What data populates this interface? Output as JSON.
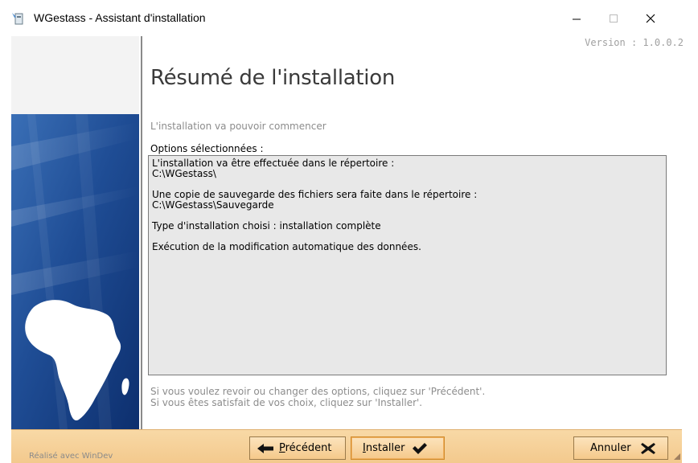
{
  "window": {
    "title": "WGestass - Assistant d'installation",
    "icon": "installer-icon"
  },
  "version": "Version : 1.0.0.2",
  "page": {
    "title": "Résumé de l'installation",
    "intro": "L'installation va pouvoir commencer",
    "options_label": "Options sélectionnées :",
    "summary": "L'installation va être effectuée dans le répertoire :\nC:\\WGestass\\\n\nUne copie de sauvegarde des fichiers sera faite dans le répertoire :\nC:\\WGestass\\Sauvegarde\n\nType d'installation choisi : installation complète\n\nExécution de la modification automatique des données.",
    "footer_line1": "Si vous voulez revoir ou changer des options, cliquez sur 'Précédent'.",
    "footer_line2": "Si vous êtes satisfait de vos choix, cliquez sur 'Installer'."
  },
  "footer": {
    "made_with": "Réalisé avec WinDev"
  },
  "buttons": {
    "prev_first": "P",
    "prev_rest": "récédent",
    "install_first": "I",
    "install_rest": "nstaller",
    "cancel": "Annuler"
  },
  "colors": {
    "bar": "#f3c98d",
    "button": "#f5c98a",
    "summary_bg": "#e8e8e8"
  }
}
